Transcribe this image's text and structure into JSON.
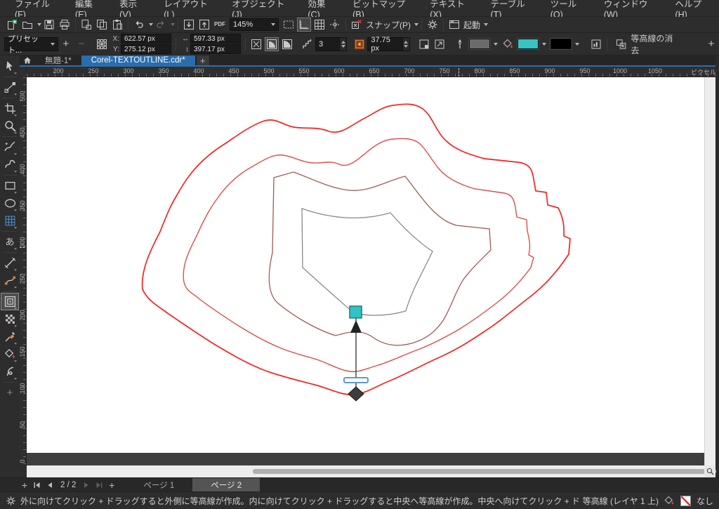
{
  "menu_bar": {
    "items": [
      "ファイル(F)",
      "編集(E)",
      "表示(V)",
      "レイアウト(L)",
      "オブジェクト(J)",
      "効果(C)",
      "ビットマップ(B)",
      "テキスト(X)",
      "テーブル(T)",
      "ツール(O)",
      "ウィンドウ(W)",
      "ヘルプ(H)"
    ]
  },
  "standard_toolbar": {
    "zoom_level": "145%",
    "pdf_label": "PDF",
    "snap_label": "スナップ(P)",
    "launch_label": "起動"
  },
  "property_bar": {
    "preset_label": "プリセット...",
    "add_preset_label": "+",
    "remove_preset_label": "−",
    "x_label": "X:",
    "x_value": "622.57 px",
    "y_label": "Y:",
    "y_value": "275.12 px",
    "width_value": "597.33 px",
    "height_value": "397.17 px",
    "width_icon": "↔",
    "height_icon": "↕",
    "steps_value": "3",
    "offset_value": "37.75 px",
    "clear_contour_label": "等高線の消去",
    "add_button_label": "+",
    "outline_color": "#6b6b6b",
    "fill_color": "#35c4c4",
    "end_color": "#000000"
  },
  "document_tabs": {
    "tabs": [
      {
        "label": "無題-1*",
        "active": false
      },
      {
        "label": "Corel-TEXTOUTLINE.cdr*",
        "active": true
      }
    ],
    "add_tab_label": "+"
  },
  "rulers": {
    "unit": "ピクセル",
    "horizontal_ticks": [
      200,
      250,
      300,
      350,
      400,
      450,
      500,
      550,
      600,
      650,
      700,
      750,
      800,
      850,
      900,
      950,
      1000,
      1050
    ],
    "vertical_ticks": [
      500,
      450,
      400,
      350,
      300,
      250,
      200,
      150,
      100,
      50,
      0
    ]
  },
  "toolbox": {
    "tools": [
      {
        "name": "pick-tool",
        "selected": false
      },
      {
        "name": "shape-tool",
        "selected": false
      },
      {
        "name": "crop-tool",
        "selected": false
      },
      {
        "name": "zoom-tool",
        "selected": false
      },
      {
        "name": "freehand-tool",
        "selected": false
      },
      {
        "name": "artistic-media-tool",
        "selected": false
      },
      {
        "name": "rectangle-tool",
        "selected": false
      },
      {
        "name": "ellipse-tool",
        "selected": false
      },
      {
        "name": "polygon-tool",
        "selected": false
      },
      {
        "name": "text-tool",
        "selected": false
      },
      {
        "name": "dimension-tool",
        "selected": false
      },
      {
        "name": "connector-tool",
        "selected": false
      },
      {
        "name": "contour-tool",
        "selected": true
      },
      {
        "name": "transparency-tool",
        "selected": false
      },
      {
        "name": "eyedropper-tool",
        "selected": false
      },
      {
        "name": "interactive-fill-tool",
        "selected": false
      },
      {
        "name": "smart-fill-tool",
        "selected": false
      },
      {
        "name": "add-tool-button",
        "selected": false
      }
    ],
    "text_tool_glyph": "あ",
    "add_tool_glyph": "+"
  },
  "canvas": {
    "contour_colors": {
      "outer": "#fb2020",
      "second": "#e14b4b",
      "third": "#9d5c55",
      "object": "#8a8a8a"
    },
    "handle_fill": "#31c3c3"
  },
  "page_bar": {
    "page_indicator": "2 / 2",
    "tabs": [
      {
        "label": "ページ 1",
        "active": false
      },
      {
        "label": "ページ 2",
        "active": true
      }
    ]
  },
  "status_bar": {
    "hint": "外に向けてクリック + ドラッグすると外側に等高線が作成。内に向けてクリック + ドラッグすると中央へ等高線が作成。中央へ向けてクリック + ドラッグすると中心へ等高線が作成。",
    "selection_info": "等高線 (レイヤ 1  上)",
    "fill_none_label": "なし"
  }
}
